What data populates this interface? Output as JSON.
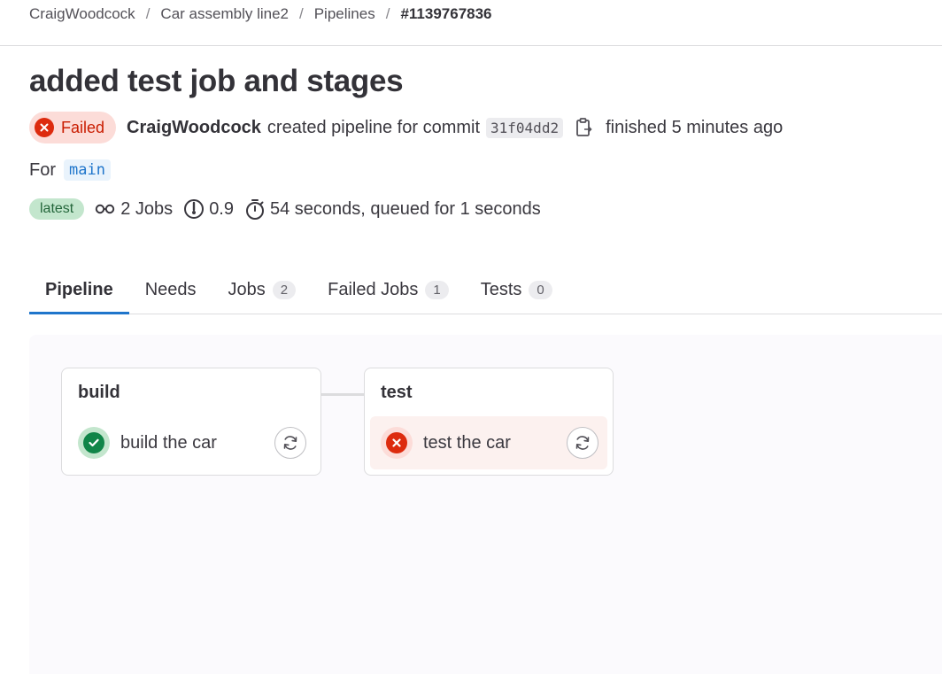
{
  "breadcrumb": {
    "items": [
      "CraigWoodcock",
      "Car assembly line2",
      "Pipelines"
    ],
    "current": "#1139767836",
    "separator": "/"
  },
  "title": "added test job and stages",
  "status": {
    "badge": "Failed",
    "author": "CraigWoodcock",
    "action_text": "created pipeline for commit",
    "commit_sha": "31f04dd2",
    "finished": "finished 5 minutes ago",
    "copy_icon": "clipboard-icon"
  },
  "ref": {
    "label": "For",
    "branch": "main"
  },
  "meta": {
    "latest": "latest",
    "jobs": "2 Jobs",
    "score": "0.9",
    "duration": "54 seconds, queued for 1 seconds"
  },
  "tabs": [
    {
      "label": "Pipeline",
      "count": null
    },
    {
      "label": "Needs",
      "count": null
    },
    {
      "label": "Jobs",
      "count": "2"
    },
    {
      "label": "Failed Jobs",
      "count": "1"
    },
    {
      "label": "Tests",
      "count": "0"
    }
  ],
  "stages": [
    {
      "name": "build",
      "job": {
        "name": "build the car",
        "status": "success"
      }
    },
    {
      "name": "test",
      "job": {
        "name": "test the car",
        "status": "failed"
      }
    }
  ],
  "colors": {
    "accent": "#1f75cb",
    "failed": "#dd2b0e",
    "success": "#108548"
  }
}
